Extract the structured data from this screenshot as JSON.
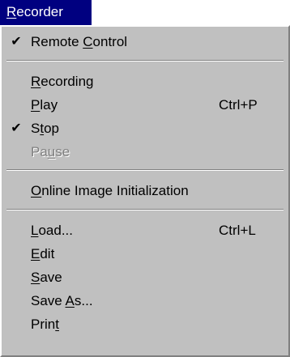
{
  "colors": {
    "menubar_bg": "#000080",
    "menu_bg": "#c0c0c0",
    "disabled_text": "#808080",
    "separator": "#808080"
  },
  "menubar": {
    "title": {
      "pre": "",
      "key": "R",
      "post": "ecorder"
    }
  },
  "menu": {
    "items": [
      {
        "id": "remote-control",
        "checked": true,
        "enabled": true,
        "pre": "Remote ",
        "key": "C",
        "post": "ontrol",
        "shortcut": ""
      },
      {
        "id": "recording",
        "checked": false,
        "enabled": true,
        "pre": "",
        "key": "R",
        "post": "ecording",
        "shortcut": ""
      },
      {
        "id": "play",
        "checked": false,
        "enabled": true,
        "pre": "",
        "key": "P",
        "post": "lay",
        "shortcut": "Ctrl+P"
      },
      {
        "id": "stop",
        "checked": true,
        "enabled": true,
        "pre": "S",
        "key": "t",
        "post": "op",
        "shortcut": ""
      },
      {
        "id": "pause",
        "checked": false,
        "enabled": false,
        "pre": "Pa",
        "key": "u",
        "post": "se",
        "shortcut": ""
      },
      {
        "id": "online-image-initialization",
        "checked": false,
        "enabled": true,
        "pre": "",
        "key": "O",
        "post": "nline Image Initialization",
        "shortcut": ""
      },
      {
        "id": "load",
        "checked": false,
        "enabled": true,
        "pre": "",
        "key": "L",
        "post": "oad...",
        "shortcut": "Ctrl+L"
      },
      {
        "id": "edit",
        "checked": false,
        "enabled": true,
        "pre": "",
        "key": "E",
        "post": "dit",
        "shortcut": ""
      },
      {
        "id": "save",
        "checked": false,
        "enabled": true,
        "pre": "",
        "key": "S",
        "post": "ave",
        "shortcut": ""
      },
      {
        "id": "save-as",
        "checked": false,
        "enabled": true,
        "pre": "Save ",
        "key": "A",
        "post": "s...",
        "shortcut": ""
      },
      {
        "id": "print",
        "checked": false,
        "enabled": true,
        "pre": "Prin",
        "key": "t",
        "post": "",
        "shortcut": ""
      }
    ],
    "check_glyph": "✔"
  }
}
